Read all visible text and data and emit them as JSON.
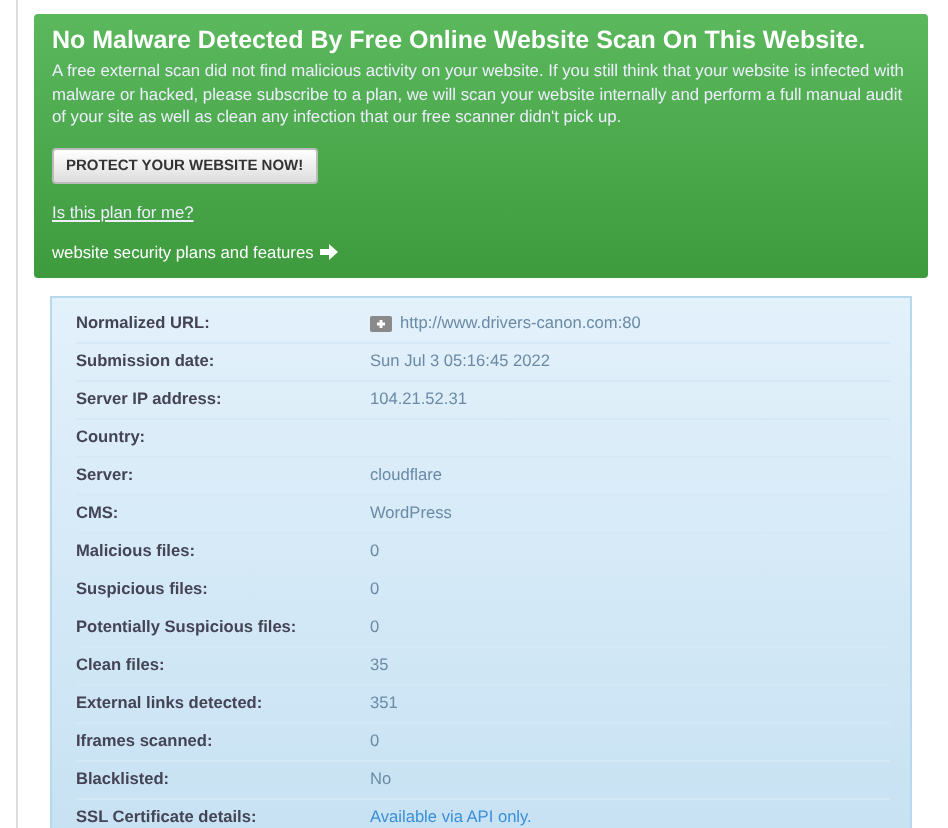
{
  "alert": {
    "title": "No Malware Detected By Free Online Website Scan On This Website.",
    "text": "A free external scan did not find malicious activity on your website. If you still think that your website is infected with malware or hacked, please subscribe to a plan, we will scan your website internally and perform a full manual audit of your site as well as clean any infection that our free scanner didn't pick up.",
    "button": "PROTECT YOUR WEBSITE NOW!",
    "link": "Is this plan for me?",
    "plans": "website security plans and features"
  },
  "details": [
    {
      "label": "Normalized URL:",
      "value": "http://www.drivers-canon.com:80",
      "kind": "url"
    },
    {
      "label": "Submission date:",
      "value": "Sun Jul 3 05:16:45 2022",
      "kind": "text"
    },
    {
      "label": "Server IP address:",
      "value": "104.21.52.31",
      "kind": "text"
    },
    {
      "label": "Country:",
      "kind": "text"
    },
    {
      "label": "Server:",
      "value": "cloudflare",
      "kind": "text"
    },
    {
      "label": "CMS:",
      "value": "WordPress",
      "kind": "text"
    },
    {
      "label": "Malicious files:",
      "value": "0",
      "kind": "text"
    },
    {
      "label": "Suspicious files:",
      "value": "0",
      "kind": "text"
    },
    {
      "label": "Potentially Suspicious files:",
      "value": "0",
      "kind": "text"
    },
    {
      "label": "Clean files:",
      "value": "35",
      "kind": "text"
    },
    {
      "label": "External links detected:",
      "value": "351",
      "kind": "text"
    },
    {
      "label": "Iframes scanned:",
      "value": "0",
      "kind": "text"
    },
    {
      "label": "Blacklisted:",
      "value": "No",
      "kind": "text"
    },
    {
      "label": "SSL Certificate details:",
      "value": "Available via API only.",
      "kind": "link"
    }
  ]
}
